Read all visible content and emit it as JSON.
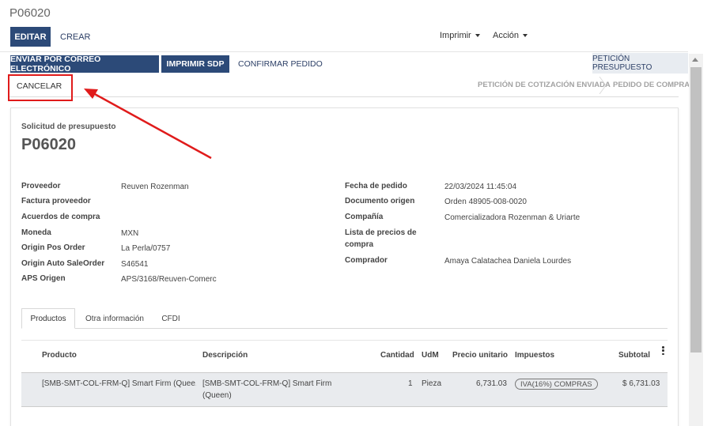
{
  "breadcrumb": "P06020",
  "toolbar": {
    "edit_label": "EDITAR",
    "create_label": "CREAR",
    "print_label": "Imprimir",
    "action_label": "Acción"
  },
  "header_buttons": {
    "send_email": "ENVIAR POR CORREO ELECTRÓNICO",
    "print_rfq": "IMPRIMIR SDP",
    "confirm": "CONFIRMAR PEDIDO",
    "cancel": "CANCELAR"
  },
  "statusbar": {
    "active": "PETICIÓN PRESUPUESTO",
    "steps": [
      "PETICIÓN DE COTIZACIÓN ENVIADA",
      "PEDIDO DE COMPRA"
    ]
  },
  "form": {
    "doc_type": "Solicitud de presupuesto",
    "name": "P06020",
    "left_fields": [
      {
        "label": "Proveedor",
        "value": "Reuven Rozenman"
      },
      {
        "label": "Factura proveedor",
        "value": ""
      },
      {
        "label": "Acuerdos de compra",
        "value": ""
      },
      {
        "label": "Moneda",
        "value": "MXN"
      },
      {
        "label": "Origin Pos Order",
        "value": "La Perla/0757"
      },
      {
        "label": "Origin Auto SaleOrder",
        "value": "S46541"
      },
      {
        "label": "APS Origen",
        "value": "APS/3168/Reuven-Comerc"
      }
    ],
    "right_fields": [
      {
        "label": "Fecha de pedido",
        "value": "22/03/2024 11:45:04"
      },
      {
        "label": "Documento origen",
        "value": "Orden 48905-008-0020"
      },
      {
        "label": "Compañía",
        "value": "Comercializadora Rozenman & Uriarte"
      },
      {
        "label": "Lista de precios de compra",
        "value": ""
      },
      {
        "label": "Comprador",
        "value": "Amaya Calatachea Daniela Lourdes"
      }
    ]
  },
  "tabs": [
    "Productos",
    "Otra información",
    "CFDI"
  ],
  "table": {
    "headers": [
      "Producto",
      "Descripción",
      "Cantidad",
      "UdM",
      "Precio unitario",
      "Impuestos",
      "Subtotal"
    ],
    "rows": [
      {
        "product": "[SMB-SMT-COL-FRM-Q] Smart Firm (Quee...",
        "description": "[SMB-SMT-COL-FRM-Q] Smart Firm (Queen)",
        "qty": "1",
        "uom": "Pieza",
        "price": "6,731.03",
        "tax": "IVA(16%) COMPRAS",
        "subtotal": "$ 6,731.03"
      }
    ]
  },
  "colors": {
    "primary": "#2c4a78",
    "highlight": "#e01b1b"
  }
}
